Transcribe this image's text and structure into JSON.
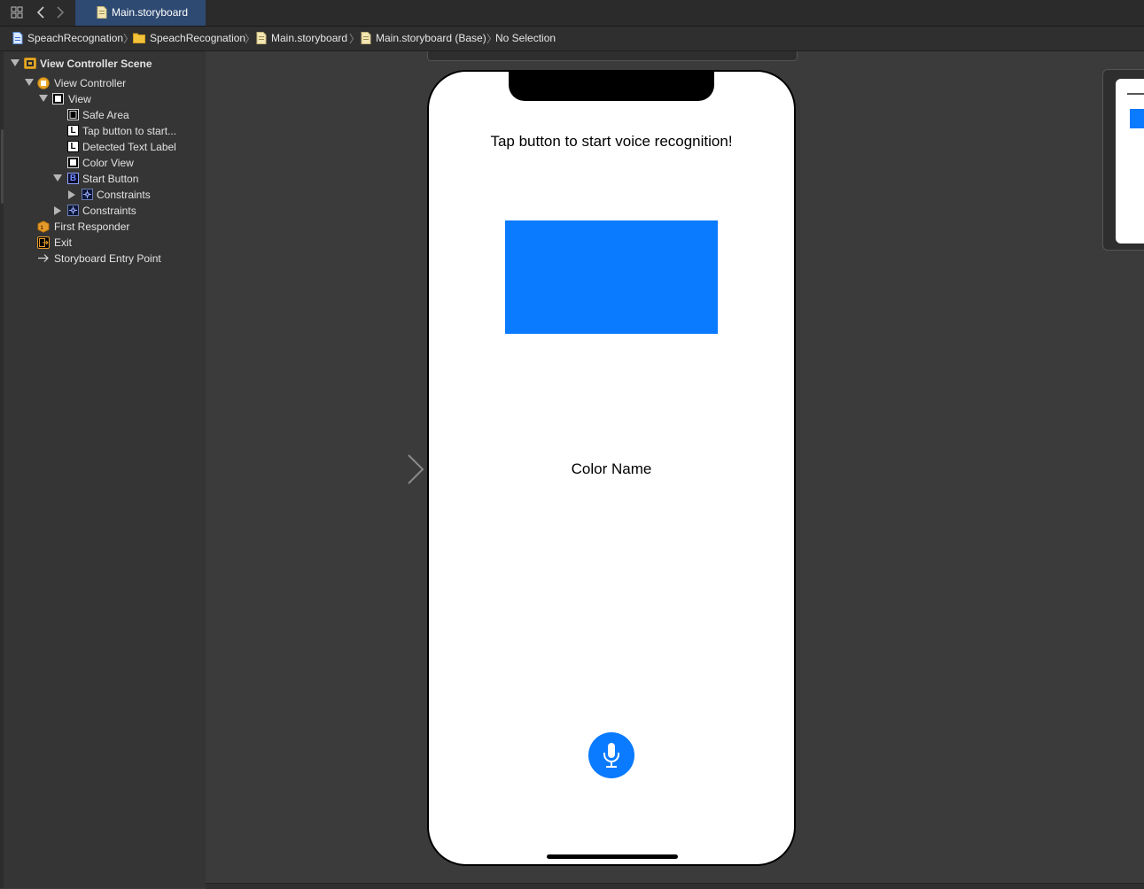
{
  "tabs": [
    {
      "label": "Main.storyboard",
      "active": true,
      "icon": "storyboard-file-icon"
    }
  ],
  "toolbar": {
    "grid_icon": "grid-icon",
    "back_icon": "chevron-left-icon",
    "forward_icon": "chevron-right-icon"
  },
  "breadcrumb": [
    {
      "label": "SpeachRecognation",
      "icon": "project-file-icon"
    },
    {
      "label": "SpeachRecognation",
      "icon": "folder-icon"
    },
    {
      "label": "Main.storyboard",
      "icon": "storyboard-file-icon"
    },
    {
      "label": "Main.storyboard (Base)",
      "icon": "storyboard-file-icon"
    },
    {
      "label": "No Selection",
      "icon": ""
    }
  ],
  "outline": {
    "items": [
      {
        "label": "View Controller Scene",
        "icon": "scene-icon",
        "expanded": true,
        "bold": true
      },
      {
        "label": "View Controller",
        "icon": "view-controller-icon",
        "expanded": true
      },
      {
        "label": "View",
        "icon": "view-icon",
        "expanded": true
      },
      {
        "label": "Safe Area",
        "icon": "safe-area-icon"
      },
      {
        "label": "Tap button to start...",
        "icon": "label-icon"
      },
      {
        "label": "Detected Text Label",
        "icon": "label-icon"
      },
      {
        "label": "Color View",
        "icon": "view-icon"
      },
      {
        "label": "Start Button",
        "icon": "button-icon",
        "expanded": true
      },
      {
        "label": "Constraints",
        "icon": "constraints-icon",
        "expanded": false
      },
      {
        "label": "Constraints",
        "icon": "constraints-icon",
        "expanded": false
      },
      {
        "label": "First Responder",
        "icon": "first-responder-icon"
      },
      {
        "label": "Exit",
        "icon": "exit-icon"
      },
      {
        "label": "Storyboard Entry Point",
        "icon": "entry-arrow-icon"
      }
    ]
  },
  "canvas": {
    "prompt_text": "Tap button to start voice recognition!",
    "color_name": "Color Name",
    "color_view_color": "#0A7AFF",
    "start_button_icon": "microphone-icon",
    "start_button_color": "#0A7AFF"
  },
  "colors": {
    "accent": "#0A7AFF",
    "tab_active": "#2E4A72"
  }
}
